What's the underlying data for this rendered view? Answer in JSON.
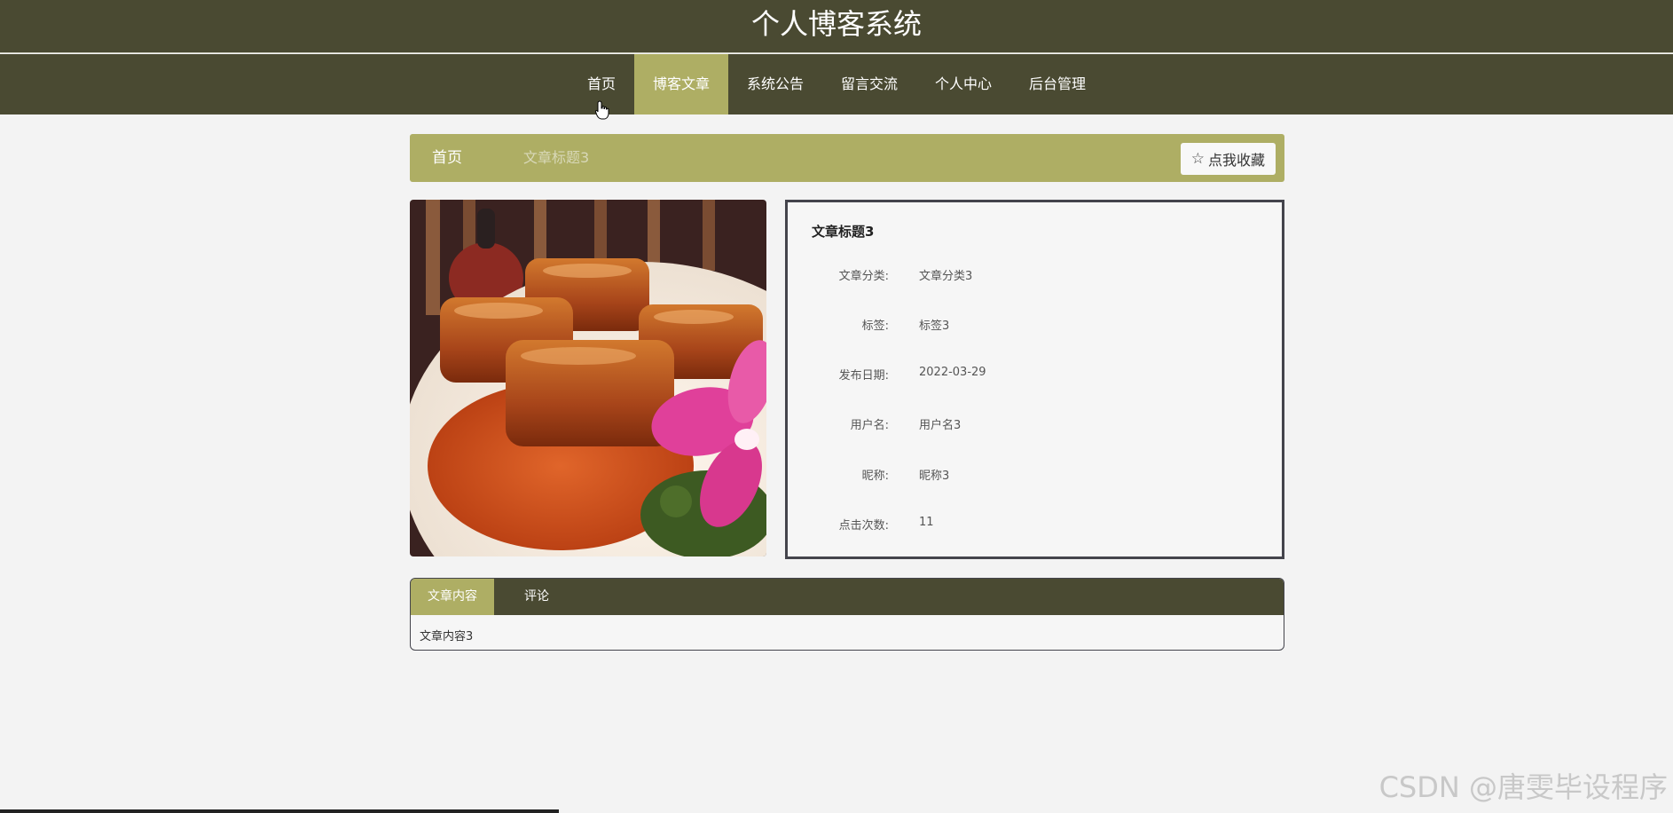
{
  "header": {
    "title": "个人博客系统"
  },
  "nav": {
    "items": [
      {
        "label": "首页"
      },
      {
        "label": "博客文章"
      },
      {
        "label": "系统公告"
      },
      {
        "label": "留言交流"
      },
      {
        "label": "个人中心"
      },
      {
        "label": "后台管理"
      }
    ],
    "active_index": 1
  },
  "breadcrumb": {
    "home": "首页",
    "current": "文章标题3",
    "collect_label": "点我收藏",
    "collect_icon": "star-outline-icon"
  },
  "article": {
    "title": "文章标题3",
    "fields": [
      {
        "label": "文章分类:",
        "value": "文章分类3"
      },
      {
        "label": "标签:",
        "value": "标签3"
      },
      {
        "label": "发布日期:",
        "value": "2022-03-29"
      },
      {
        "label": "用户名:",
        "value": "用户名3"
      },
      {
        "label": "昵称:",
        "value": "昵称3"
      },
      {
        "label": "点击次数:",
        "value": "11"
      }
    ]
  },
  "tabs": {
    "items": [
      {
        "label": "文章内容"
      },
      {
        "label": "评论"
      }
    ],
    "active_index": 0,
    "content": "文章内容3"
  },
  "watermark": "CSDN @唐雯毕设程序",
  "colors": {
    "header_bg": "#4a4a32",
    "accent": "#aeae64",
    "page_bg": "#f3f3f3"
  }
}
